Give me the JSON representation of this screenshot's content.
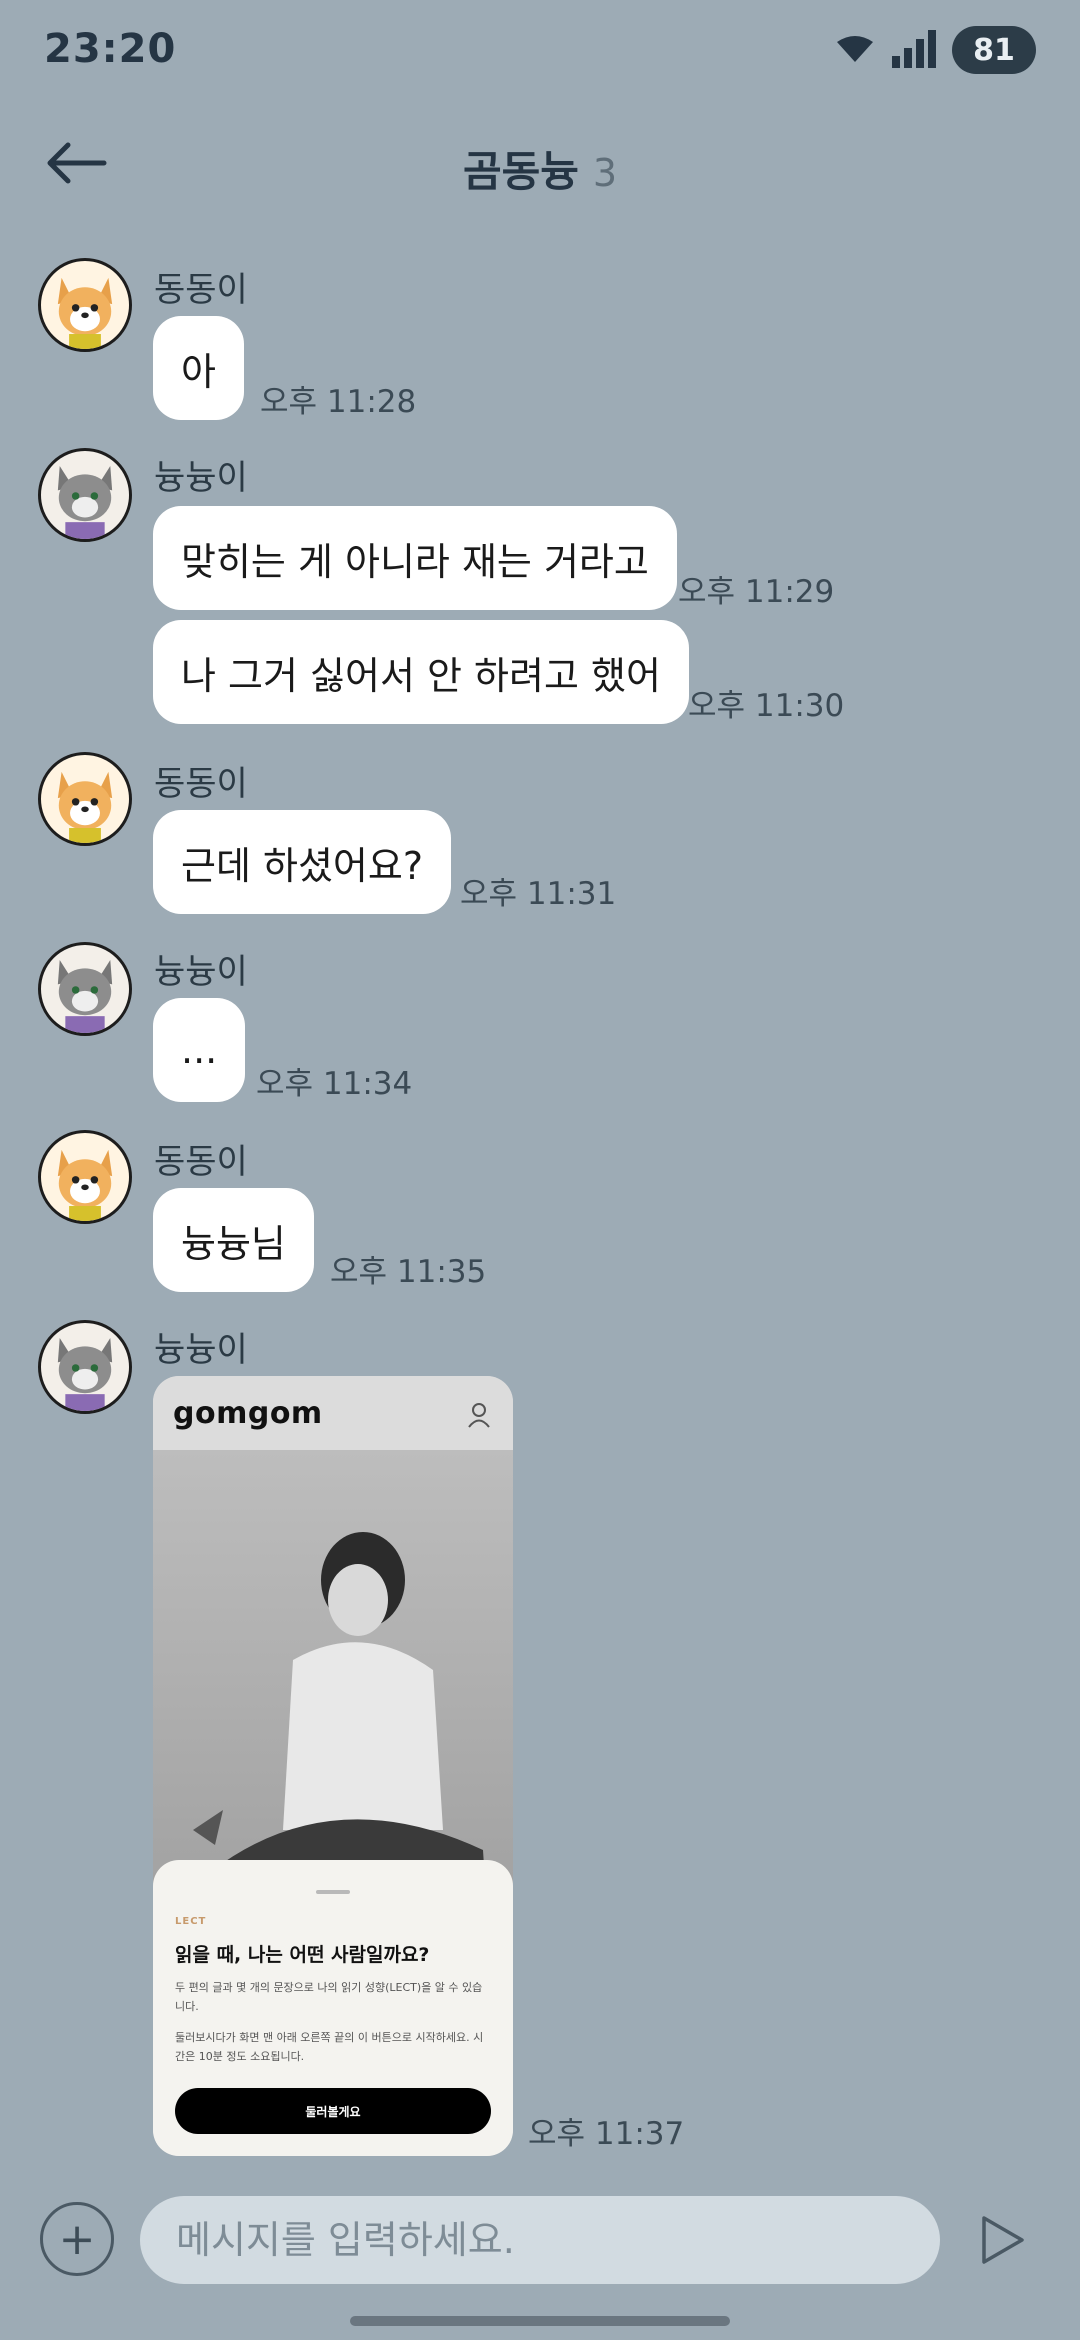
{
  "status_bar": {
    "time": "23:20",
    "battery": "81"
  },
  "header": {
    "title": "곰동늉",
    "count": "3",
    "back_icon": "arrow-left-icon"
  },
  "messages": [
    {
      "sender": "동동이",
      "avatar": "dog-avatar",
      "text": "아",
      "time": "오후 11:28"
    },
    {
      "sender": "늉늉이",
      "avatar": "cat-avatar",
      "text": "맞히는 게 아니라 재는 거라고",
      "time": "오후 11:29"
    },
    {
      "text": "나 그거 싫어서 안 하려고 했어",
      "time": "오후 11:30"
    },
    {
      "sender": "동동이",
      "avatar": "dog-avatar",
      "text": "근데 하셨어요?",
      "time": "오후 11:31"
    },
    {
      "sender": "늉늉이",
      "avatar": "cat-avatar",
      "text": "...",
      "time": "오후 11:34"
    },
    {
      "sender": "동동이",
      "avatar": "dog-avatar",
      "text": "늉늉님",
      "time": "오후 11:35"
    },
    {
      "sender": "늉늉이",
      "avatar": "cat-avatar",
      "time": "오후 11:37",
      "image": {
        "logo": "gomgom",
        "tag": "LECT",
        "heading": "읽을 때, 나는 어떤 사람일까요?",
        "para1": "두 편의 글과 몇 개의 문장으로 나의 읽기 성향(LECT)을 알 수 있습니다.",
        "para2": "둘러보시다가 화면 맨 아래 오른쪽 끝의 이 버튼으로 시작하세요. 시간은 10분 정도 소요됩니다.",
        "cta": "둘러볼게요"
      }
    }
  ],
  "input": {
    "placeholder": "메시지를 입력하세요.",
    "value": ""
  },
  "colors": {
    "background": "#9dabb5",
    "bubble": "#ffffff",
    "input": "#d2dbe1"
  }
}
